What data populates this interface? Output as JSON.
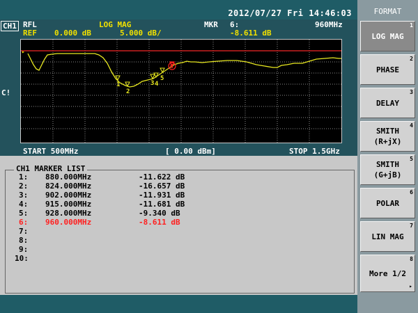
{
  "datetime": "2012/07/27 Fri 14:46:03",
  "channel": {
    "label": "CH1",
    "param": "RFL",
    "format": "LOG MAG",
    "ref_label": "REF",
    "ref_value": "0.000 dB",
    "scale": "5.000 dB/"
  },
  "marker_readout": {
    "label": "MKR",
    "number": "6:",
    "frequency": "960MHz",
    "value": "-8.611 dB"
  },
  "side_label": "C!",
  "sweep": {
    "start": "START 500MHz",
    "power": "[ 0.00 dBm]",
    "stop": "STOP 1.5GHz"
  },
  "marker_list": {
    "title": "CH1 MARKER LIST",
    "rows": [
      {
        "no": "1:",
        "freq": "880.000MHz",
        "value": "-11.622 dB"
      },
      {
        "no": "2:",
        "freq": "824.000MHz",
        "value": "-16.657 dB"
      },
      {
        "no": "3:",
        "freq": "902.000MHz",
        "value": "-11.931 dB"
      },
      {
        "no": "4:",
        "freq": "915.000MHz",
        "value": "-11.681 dB"
      },
      {
        "no": "5:",
        "freq": "928.000MHz",
        "value": "-9.340 dB"
      },
      {
        "no": "6:",
        "freq": "960.000MHz",
        "value": "-8.611 dB"
      },
      {
        "no": "7:",
        "freq": "",
        "value": ""
      },
      {
        "no": "8:",
        "freq": "",
        "value": ""
      },
      {
        "no": "9:",
        "freq": "",
        "value": ""
      },
      {
        "no": "10:",
        "freq": "",
        "value": ""
      }
    ]
  },
  "menu": {
    "title": "FORMAT",
    "keys": [
      {
        "label": "LOG MAG",
        "num": "1"
      },
      {
        "label": "PHASE",
        "num": "2"
      },
      {
        "label": "DELAY",
        "num": "3"
      },
      {
        "label": "SMITH\n(R+jX)",
        "num": "4"
      },
      {
        "label": "SMITH\n(G+jB)",
        "num": "5"
      },
      {
        "label": "POLAR",
        "num": "6"
      },
      {
        "label": "LIN MAG",
        "num": "7"
      },
      {
        "label": "More 1/2",
        "num": "8"
      }
    ],
    "more_arrow": "▸"
  },
  "trace": {
    "color": "#e8e820",
    "ref_line_color": "#cc2020",
    "active_marker_color": "#ff2020",
    "marker_labels": [
      "1",
      "2",
      "3",
      "4",
      "5",
      "6"
    ],
    "ref_marker": "▸"
  }
}
